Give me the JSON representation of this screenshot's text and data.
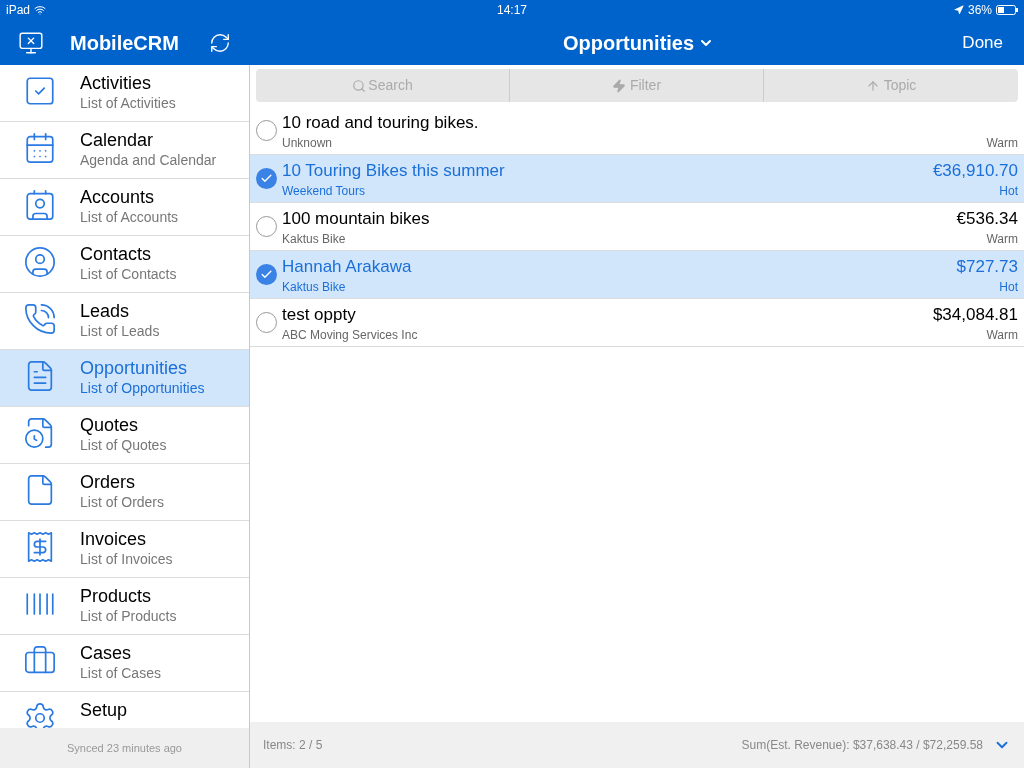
{
  "status_bar": {
    "device": "iPad",
    "time": "14:17",
    "battery": "36%"
  },
  "nav": {
    "app_title": "MobileCRM",
    "title": "Opportunities",
    "done": "Done"
  },
  "sidebar": {
    "items": [
      {
        "label": "Activities",
        "sublabel": "List of Activities",
        "selected": false
      },
      {
        "label": "Calendar",
        "sublabel": "Agenda and Calendar",
        "selected": false
      },
      {
        "label": "Accounts",
        "sublabel": "List of Accounts",
        "selected": false
      },
      {
        "label": "Contacts",
        "sublabel": "List of Contacts",
        "selected": false
      },
      {
        "label": "Leads",
        "sublabel": "List of Leads",
        "selected": false
      },
      {
        "label": "Opportunities",
        "sublabel": "List of Opportunities",
        "selected": true
      },
      {
        "label": "Quotes",
        "sublabel": "List of Quotes",
        "selected": false
      },
      {
        "label": "Orders",
        "sublabel": "List of Orders",
        "selected": false
      },
      {
        "label": "Invoices",
        "sublabel": "List of Invoices",
        "selected": false
      },
      {
        "label": "Products",
        "sublabel": "List of Products",
        "selected": false
      },
      {
        "label": "Cases",
        "sublabel": "List of Cases",
        "selected": false
      },
      {
        "label": "Setup",
        "selected": false
      }
    ],
    "footer": "Synced 23 minutes ago"
  },
  "toolbar": {
    "search": "Search",
    "filter": "Filter",
    "sort": "Topic"
  },
  "rows": [
    {
      "title": "10 road and touring bikes.",
      "subtitle": "Unknown",
      "status": "Warm",
      "selected": false
    },
    {
      "title": "10 Touring Bikes this summer",
      "subtitle": "Weekend Tours",
      "amount": "€36,910.70",
      "status": "Hot",
      "selected": true
    },
    {
      "title": "100 mountain bikes",
      "subtitle": "Kaktus Bike",
      "amount": "€536.34",
      "status": "Warm",
      "selected": false
    },
    {
      "title": "Hannah Arakawa",
      "subtitle": "Kaktus Bike",
      "amount": "$727.73",
      "status": "Hot",
      "selected": true
    },
    {
      "title": "test oppty",
      "subtitle": "ABC Moving Services Inc",
      "amount": "$34,084.81",
      "status": "Warm",
      "selected": false
    }
  ],
  "footer": {
    "items": "Items: 2 / 5",
    "sum": "Sum(Est. Revenue): $37,638.43 / $72,259.58"
  }
}
